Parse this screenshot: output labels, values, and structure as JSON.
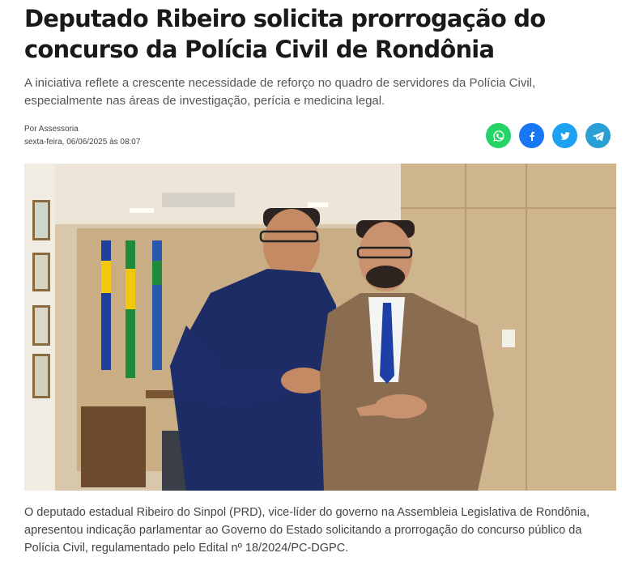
{
  "article": {
    "headline": "Deputado Ribeiro solicita prorrogação do concurso da Polícia Civil de Rondônia",
    "subtitle": "A iniciativa reflete a crescente necessidade de reforço no quadro de servidores da Polícia Civil, especialmente nas áreas de investigação, perícia e medicina legal.",
    "author": "Por Assessoria",
    "date": "sexta-feira, 06/06/2025 às 08:07",
    "lead": "O deputado estadual Ribeiro do Sinpol (PRD), vice-líder do governo na Assembleia Legislativa de Rondônia, apresentou indicação parlamentar ao Governo do Estado solicitando a prorrogação do concurso público da Polícia Civil, regulamentado pelo Edital nº 18/2024/PC-DGPC."
  },
  "share_buttons": [
    {
      "network": "whatsapp",
      "icon": "whatsapp-icon",
      "color": "#25d366"
    },
    {
      "network": "facebook",
      "icon": "facebook-icon",
      "color": "#1877f2"
    },
    {
      "network": "twitter",
      "icon": "twitter-icon",
      "color": "#1da1f2"
    },
    {
      "network": "telegram",
      "icon": "telegram-icon",
      "color": "#2a9fd6"
    }
  ],
  "photo": {
    "subject": "two-men-in-office-photo"
  }
}
